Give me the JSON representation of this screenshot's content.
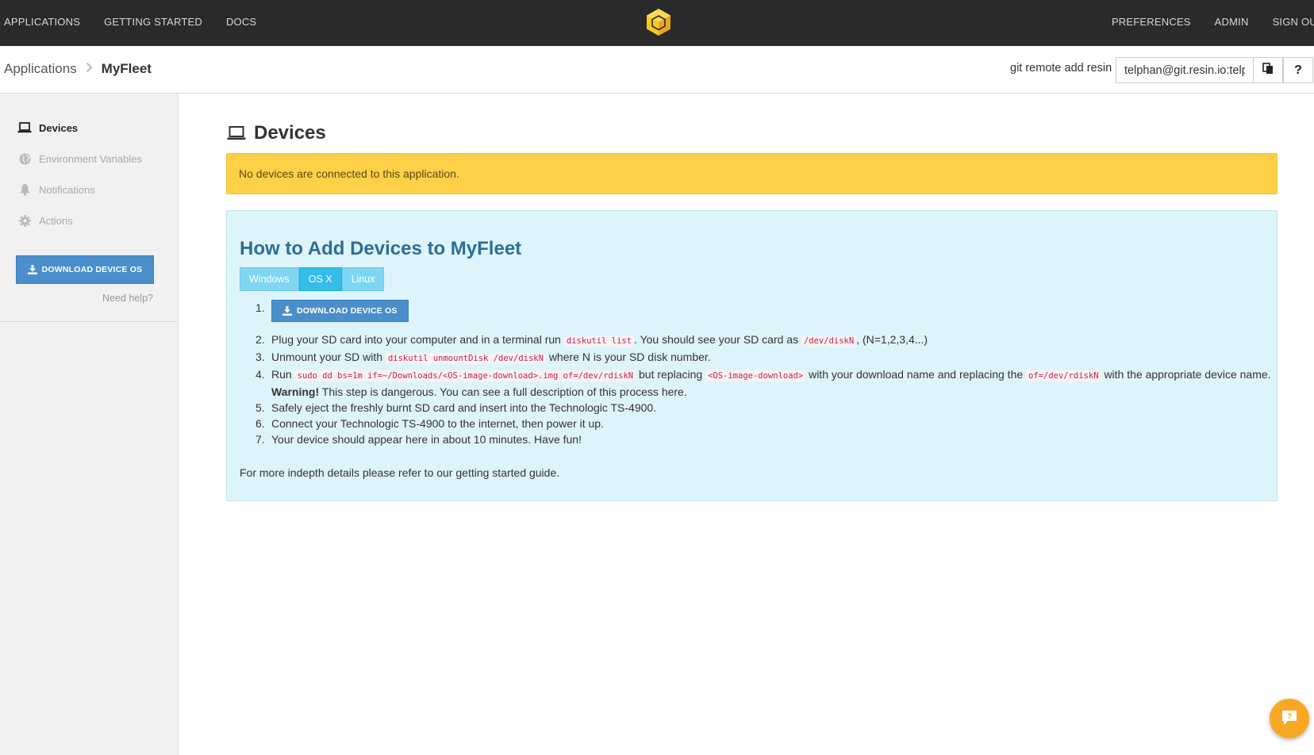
{
  "topnav": {
    "left": [
      "APPLICATIONS",
      "GETTING STARTED",
      "DOCS"
    ],
    "right": [
      "PREFERENCES",
      "ADMIN",
      "SIGN OUT"
    ]
  },
  "breadcrumb": {
    "parent": "Applications",
    "current": "MyFleet"
  },
  "git": {
    "label": "git remote add resin",
    "value": "telphan@git.resin.io:telphan/myfleet.git",
    "copy_icon": "copy-icon",
    "help_label": "?"
  },
  "sidebar": {
    "items": [
      {
        "label": "Devices",
        "icon": "laptop-icon",
        "active": true
      },
      {
        "label": "Environment Variables",
        "icon": "globe-icon",
        "active": false
      },
      {
        "label": "Notifications",
        "icon": "bell-icon",
        "active": false
      },
      {
        "label": "Actions",
        "icon": "gear-icon",
        "active": false
      }
    ],
    "download_label": "DOWNLOAD DEVICE OS",
    "need_help": "Need help?"
  },
  "main": {
    "title": "Devices",
    "alert": "No devices are connected to this application.",
    "panel": {
      "title": "How to Add Devices to MyFleet",
      "tabs": [
        "Windows",
        "OS X",
        "Linux"
      ],
      "active_tab": "OS X",
      "step1_button": "DOWNLOAD DEVICE OS",
      "step2": {
        "a": "Plug your SD card into your computer and in a terminal run",
        "code1": "diskutil list",
        "b": ". You should see your SD card as",
        "code2": "/dev/diskN",
        "c": ", (N=1,2,3,4...)"
      },
      "step3": {
        "a": "Unmount your SD with",
        "code1": "diskutil unmountDisk /dev/diskN",
        "b": "where N is your SD disk number."
      },
      "step4": {
        "a": "Run",
        "code1": "sudo dd bs=1m if=~/Downloads/<OS-image-download>.img of=/dev/rdiskN",
        "b": "but replacing",
        "code2": "<OS-image-download>",
        "c": "with your download name and replacing the",
        "code3": "of=/dev/rdiskN",
        "d": "with the appropriate device name.",
        "warning_bold": "Warning!",
        "warning_text": "This step is dangerous. You can see a full description of this process",
        "warning_link": "here",
        "warning_end": "."
      },
      "step5": "Safely eject the freshly burnt SD card and insert into the Technologic TS-4900.",
      "step6": "Connect your Technologic TS-4900 to the internet, then power it up.",
      "step7": "Your device should appear here in about 10 minutes. Have fun!",
      "more_text": "For more indepth details please refer to our",
      "more_link": "getting started guide",
      "more_end": "."
    }
  },
  "colors": {
    "topbar": "#2a2a2a",
    "accent_blue": "#4a8fcb",
    "alert_yellow": "#fdd048",
    "panel_blue": "#def4fb",
    "tab_active": "#33bde8",
    "chat_orange": "#f9a825"
  }
}
